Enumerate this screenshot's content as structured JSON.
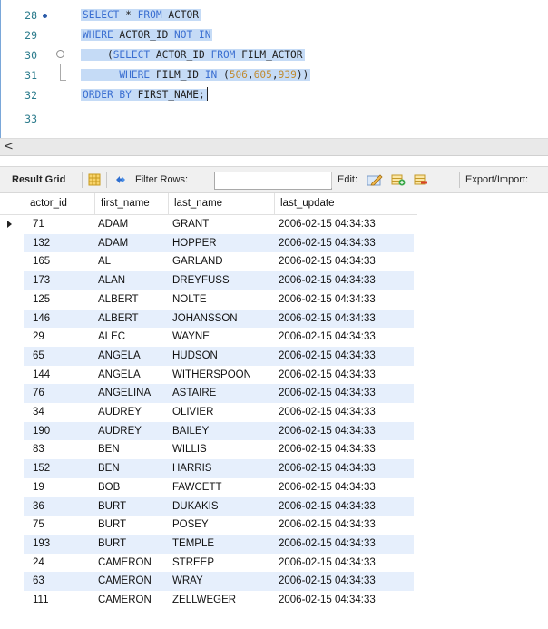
{
  "editor": {
    "lines": [
      {
        "num": "28",
        "tokens": [
          {
            "t": "SELECT",
            "c": "kw"
          },
          {
            "t": " * "
          },
          {
            "t": "FROM",
            "c": "kw"
          },
          {
            "t": " ACTOR"
          }
        ]
      },
      {
        "num": "29",
        "tokens": [
          {
            "t": "WHERE",
            "c": "kw"
          },
          {
            "t": " ACTOR_ID "
          },
          {
            "t": "NOT IN",
            "c": "kw"
          }
        ]
      },
      {
        "num": "30",
        "tokens": [
          {
            "t": "    ("
          },
          {
            "t": "SELECT",
            "c": "kw"
          },
          {
            "t": " ACTOR_ID "
          },
          {
            "t": "FROM",
            "c": "kw"
          },
          {
            "t": " FILM_ACTOR"
          }
        ]
      },
      {
        "num": "31",
        "tokens": [
          {
            "t": "      "
          },
          {
            "t": "WHERE",
            "c": "kw"
          },
          {
            "t": " FILM_ID "
          },
          {
            "t": "IN",
            "c": "kw"
          },
          {
            "t": " ("
          },
          {
            "t": "506",
            "c": "num"
          },
          {
            "t": ","
          },
          {
            "t": "605",
            "c": "num"
          },
          {
            "t": ","
          },
          {
            "t": "939",
            "c": "num"
          },
          {
            "t": "))"
          }
        ]
      },
      {
        "num": "32",
        "tokens": [
          {
            "t": "ORDER BY",
            "c": "kw"
          },
          {
            "t": " FIRST_NAME;"
          }
        ]
      },
      {
        "num": "33",
        "tokens": []
      }
    ],
    "scroll_arrow": "<"
  },
  "toolbar": {
    "result_grid": "Result Grid",
    "filter_rows": "Filter Rows:",
    "filter_value": "",
    "edit": "Edit:",
    "export": "Export/Import:"
  },
  "grid": {
    "columns": [
      "actor_id",
      "first_name",
      "last_name",
      "last_update"
    ],
    "rows": [
      [
        "71",
        "ADAM",
        "GRANT",
        "2006-02-15 04:34:33"
      ],
      [
        "132",
        "ADAM",
        "HOPPER",
        "2006-02-15 04:34:33"
      ],
      [
        "165",
        "AL",
        "GARLAND",
        "2006-02-15 04:34:33"
      ],
      [
        "173",
        "ALAN",
        "DREYFUSS",
        "2006-02-15 04:34:33"
      ],
      [
        "125",
        "ALBERT",
        "NOLTE",
        "2006-02-15 04:34:33"
      ],
      [
        "146",
        "ALBERT",
        "JOHANSSON",
        "2006-02-15 04:34:33"
      ],
      [
        "29",
        "ALEC",
        "WAYNE",
        "2006-02-15 04:34:33"
      ],
      [
        "65",
        "ANGELA",
        "HUDSON",
        "2006-02-15 04:34:33"
      ],
      [
        "144",
        "ANGELA",
        "WITHERSPOON",
        "2006-02-15 04:34:33"
      ],
      [
        "76",
        "ANGELINA",
        "ASTAIRE",
        "2006-02-15 04:34:33"
      ],
      [
        "34",
        "AUDREY",
        "OLIVIER",
        "2006-02-15 04:34:33"
      ],
      [
        "190",
        "AUDREY",
        "BAILEY",
        "2006-02-15 04:34:33"
      ],
      [
        "83",
        "BEN",
        "WILLIS",
        "2006-02-15 04:34:33"
      ],
      [
        "152",
        "BEN",
        "HARRIS",
        "2006-02-15 04:34:33"
      ],
      [
        "19",
        "BOB",
        "FAWCETT",
        "2006-02-15 04:34:33"
      ],
      [
        "36",
        "BURT",
        "DUKAKIS",
        "2006-02-15 04:34:33"
      ],
      [
        "75",
        "BURT",
        "POSEY",
        "2006-02-15 04:34:33"
      ],
      [
        "193",
        "BURT",
        "TEMPLE",
        "2006-02-15 04:34:33"
      ],
      [
        "24",
        "CAMERON",
        "STREEP",
        "2006-02-15 04:34:33"
      ],
      [
        "63",
        "CAMERON",
        "WRAY",
        "2006-02-15 04:34:33"
      ],
      [
        "111",
        "CAMERON",
        "ZELLWEGER",
        "2006-02-15 04:34:33"
      ]
    ]
  },
  "colors": {
    "selection": "#c5dbf6",
    "keyword": "#3b6fd1",
    "number": "#c08a2e",
    "row_alt": "#e6effc"
  },
  "icons": [
    "grid-layout-icon",
    "refresh-icon",
    "edit-pencil-icon",
    "add-row-icon",
    "delete-row-icon"
  ]
}
